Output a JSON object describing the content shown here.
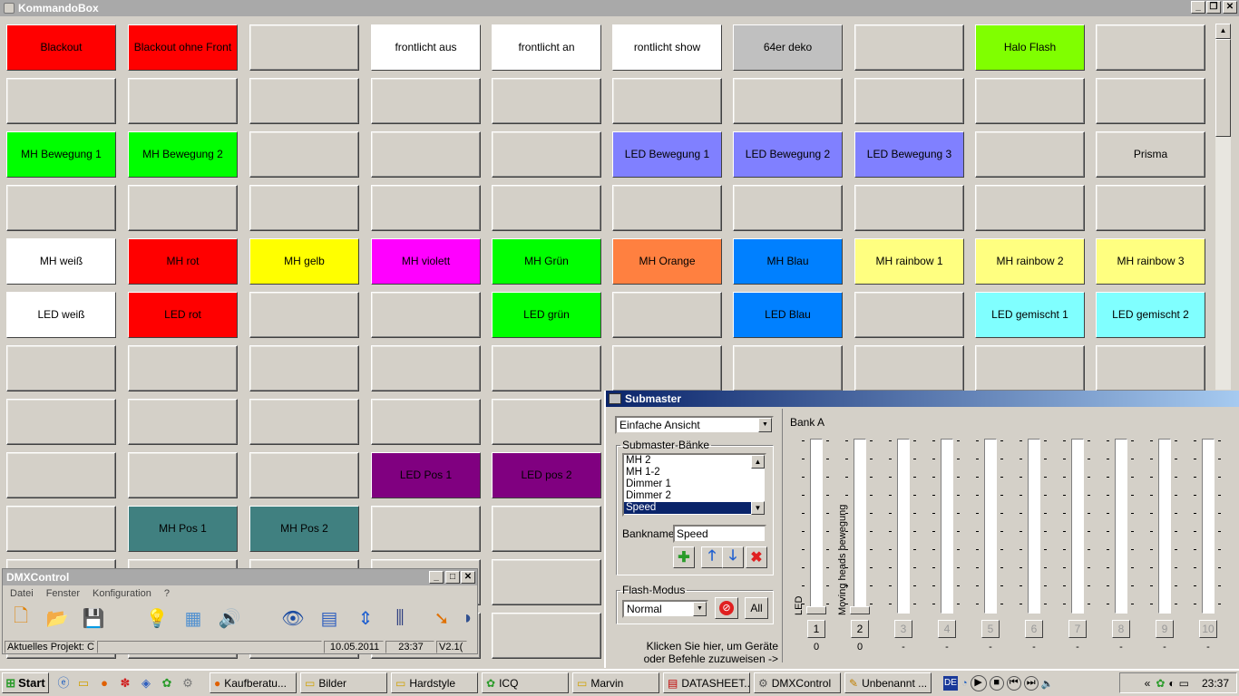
{
  "window": {
    "title": "KommandoBox",
    "minimize": "_",
    "maximize": "❐",
    "close": "✕"
  },
  "buttons": [
    [
      "Blackout",
      "Blackout ohne Front",
      "",
      "frontlicht aus",
      "frontlicht an",
      "rontlicht show",
      "64er deko",
      "",
      "Halo Flash",
      ""
    ],
    [
      "",
      "",
      "",
      "",
      "",
      "",
      "",
      "",
      "",
      ""
    ],
    [
      "MH Bewegung 1",
      "MH Bewegung 2",
      "",
      "",
      "",
      "LED Bewegung 1",
      "LED Bewegung 2",
      "LED Bewegung 3",
      "",
      "Prisma"
    ],
    [
      "",
      "",
      "",
      "",
      "",
      "",
      "",
      "",
      "",
      ""
    ],
    [
      "MH weiß",
      "MH rot",
      "MH gelb",
      "MH violett",
      "MH Grün",
      "MH Orange",
      "MH Blau",
      "MH rainbow 1",
      "MH rainbow 2",
      "MH rainbow 3"
    ],
    [
      "LED weiß",
      "LED rot",
      "",
      "",
      "LED grün",
      "",
      "LED Blau",
      "",
      "LED gemischt 1",
      "LED gemischt 2"
    ],
    [
      "",
      "",
      "",
      "",
      "",
      "",
      "",
      "",
      "",
      ""
    ],
    [
      "",
      "",
      "",
      "",
      "",
      "",
      "",
      "",
      "",
      ""
    ],
    [
      "",
      "",
      "",
      "LED Pos 1",
      "LED pos 2",
      "",
      "",
      "",
      "",
      ""
    ],
    [
      "",
      "MH Pos 1",
      "MH Pos 2",
      "",
      "",
      "",
      "",
      "",
      "",
      ""
    ]
  ],
  "colors": [
    [
      "#ff0000",
      "#ff0000",
      "",
      "#ffffff",
      "#ffffff",
      "#ffffff",
      "#c0c0c0",
      "",
      "#80ff00",
      ""
    ],
    [
      "",
      "",
      "",
      "",
      "",
      "",
      "",
      "",
      "",
      ""
    ],
    [
      "#00ff00",
      "#00ff00",
      "",
      "",
      "",
      "#8080ff",
      "#8080ff",
      "#8080ff",
      "",
      ""
    ],
    [
      "",
      "",
      "",
      "",
      "",
      "",
      "",
      "",
      "",
      ""
    ],
    [
      "#ffffff",
      "#ff0000",
      "#ffff00",
      "#ff00ff",
      "#00ff00",
      "#ff8040",
      "#0080ff",
      "#ffff80",
      "#ffff80",
      "#ffff80"
    ],
    [
      "#ffffff",
      "#ff0000",
      "",
      "",
      "#00ff00",
      "",
      "#0080ff",
      "",
      "#80ffff",
      "#80ffff"
    ],
    [
      "",
      "",
      "",
      "",
      "",
      "",
      "",
      "",
      "",
      ""
    ],
    [
      "",
      "",
      "",
      "",
      "",
      "",
      "",
      "",
      "",
      ""
    ],
    [
      "",
      "",
      "",
      "#800080",
      "#800080",
      "",
      "",
      "",
      "",
      ""
    ],
    [
      "",
      "#408080",
      "#408080",
      "",
      "",
      "",
      "",
      "",
      "",
      ""
    ]
  ],
  "submaster": {
    "title": "Submaster",
    "view_select": "Einfache Ansicht",
    "banks_legend": "Submaster-Bänke",
    "banks": [
      "MH 2",
      "MH 1-2",
      "Dimmer 1",
      "Dimmer 2",
      "Speed"
    ],
    "selected_bank": "Speed",
    "bankname_label": "Bankname:",
    "bankname_value": "Speed",
    "flash_legend": "Flash-Modus",
    "flash_mode": "Normal",
    "all_label": "All",
    "hint": "Klicken Sie hier, um Geräte oder Befehle zuzuweisen ->",
    "bank_label": "Bank A",
    "faders": [
      {
        "num": "1",
        "label": "LED",
        "value": "0",
        "active": true,
        "level": 0
      },
      {
        "num": "2",
        "label": "Moving heads bewegung",
        "value": "0",
        "active": true,
        "level": 0
      },
      {
        "num": "3",
        "label": "",
        "value": "-",
        "active": false,
        "level": 0
      },
      {
        "num": "4",
        "label": "",
        "value": "-",
        "active": false,
        "level": 0
      },
      {
        "num": "5",
        "label": "",
        "value": "-",
        "active": false,
        "level": 0
      },
      {
        "num": "6",
        "label": "",
        "value": "-",
        "active": false,
        "level": 0
      },
      {
        "num": "7",
        "label": "",
        "value": "-",
        "active": false,
        "level": 0
      },
      {
        "num": "8",
        "label": "",
        "value": "-",
        "active": false,
        "level": 0
      },
      {
        "num": "9",
        "label": "",
        "value": "-",
        "active": false,
        "level": 0
      },
      {
        "num": "10",
        "label": "",
        "value": "-",
        "active": false,
        "level": 0
      }
    ]
  },
  "dmx": {
    "title": "DMXControl",
    "menu": [
      "Datei",
      "Fenster",
      "Konfiguration",
      "?"
    ],
    "status_project": "Aktuelles Projekt: C",
    "status_date": "10.05.2011",
    "status_time": "23:37",
    "status_version": "V2.1("
  },
  "taskbar": {
    "start": "Start",
    "tasks": [
      "Kaufberatu...",
      "Bilder",
      "Hardstyle",
      "ICQ",
      "Marvin",
      "DATASHEET...",
      "DMXControl",
      "Unbenannt ..."
    ],
    "lang": "DE",
    "clock": "23:37"
  }
}
